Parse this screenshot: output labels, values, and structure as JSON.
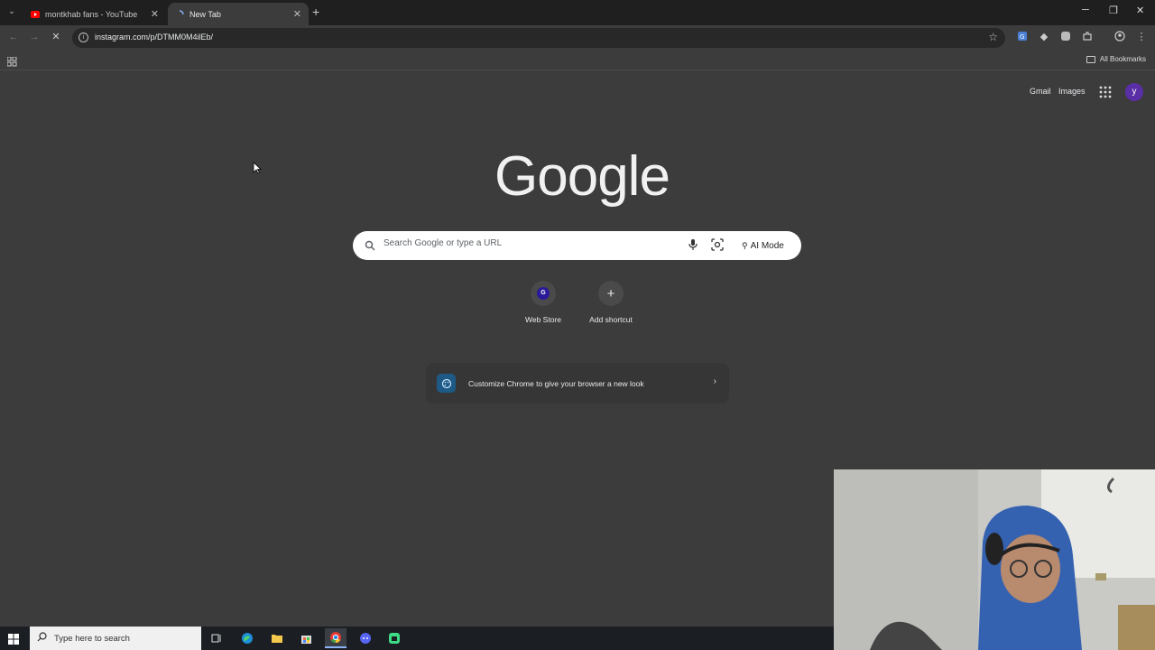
{
  "tabs": [
    {
      "title": "montkhab fans - YouTube",
      "active": false,
      "favicon": "youtube-icon"
    },
    {
      "title": "New Tab",
      "active": true,
      "favicon": "loading-spinner-icon"
    }
  ],
  "toolbar": {
    "url": "instagram.com/p/DTMM0M4ilEb/"
  },
  "bookmarks": {
    "all_bookmarks_label": "All Bookmarks"
  },
  "ntp": {
    "gmail_label": "Gmail",
    "images_label": "Images",
    "avatar_letter": "y",
    "logo_text": "Google",
    "search_placeholder": "Search Google or type a URL",
    "ai_mode_label": "AI Mode",
    "shortcuts": [
      {
        "label": "Web Store",
        "icon_letter": "G"
      },
      {
        "label": "Add shortcut"
      }
    ],
    "customize_text": "Customize Chrome to give your browser a new look"
  },
  "taskbar": {
    "search_placeholder": "Type here to search",
    "apps": [
      "task-view-icon",
      "edge-icon",
      "file-explorer-icon",
      "store-icon",
      "chrome-icon",
      "discord-icon",
      "app-icon"
    ]
  },
  "colors": {
    "page_bg": "#3c3c3c",
    "tabstrip_bg": "#1f1f1f",
    "avatar_bg": "#5a2ea6",
    "taskbar_bg": "#1b1f24"
  }
}
